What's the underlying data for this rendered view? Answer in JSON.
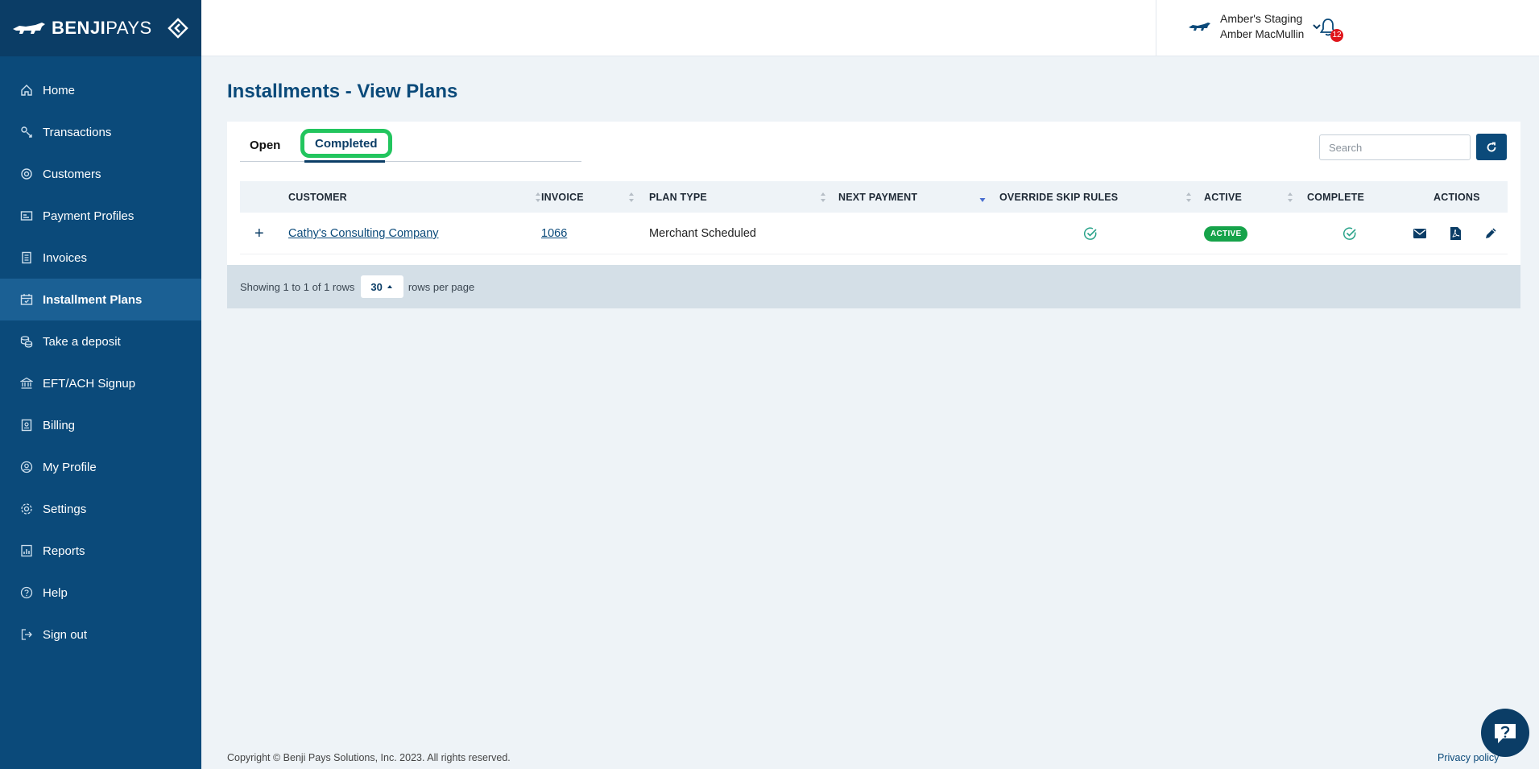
{
  "brand": {
    "name_bold": "BENJI",
    "name_thin": "PAYS"
  },
  "colors": {
    "sidebar": "#0b4a7a",
    "accent": "#0b3d66",
    "highlight": "#22c55e",
    "active_badge": "#16a34a",
    "notification": "#e0161b"
  },
  "sidebar": {
    "items": [
      {
        "label": "Home",
        "icon": "home-icon"
      },
      {
        "label": "Transactions",
        "icon": "transactions-icon"
      },
      {
        "label": "Customers",
        "icon": "customers-icon"
      },
      {
        "label": "Payment Profiles",
        "icon": "payment-profiles-icon"
      },
      {
        "label": "Invoices",
        "icon": "invoices-icon"
      },
      {
        "label": "Installment Plans",
        "icon": "calendar-icon",
        "active": true
      },
      {
        "label": "Take a deposit",
        "icon": "coins-icon"
      },
      {
        "label": "EFT/ACH Signup",
        "icon": "bank-icon"
      },
      {
        "label": "Billing",
        "icon": "billing-icon"
      },
      {
        "label": "My Profile",
        "icon": "user-icon"
      },
      {
        "label": "Settings",
        "icon": "gear-icon"
      },
      {
        "label": "Reports",
        "icon": "reports-icon"
      },
      {
        "label": "Help",
        "icon": "help-icon"
      },
      {
        "label": "Sign out",
        "icon": "sign-out-icon"
      }
    ]
  },
  "topbar": {
    "notification_count": "12",
    "account_name": "Amber's Staging",
    "user_name": "Amber MacMullin"
  },
  "page": {
    "title": "Installments - View Plans"
  },
  "tabs": {
    "open": "Open",
    "completed": "Completed"
  },
  "search": {
    "placeholder": "Search"
  },
  "table": {
    "columns": [
      "CUSTOMER",
      "INVOICE",
      "PLAN TYPE",
      "NEXT PAYMENT",
      "OVERRIDE SKIP RULES",
      "ACTIVE",
      "COMPLETE",
      "ACTIONS"
    ],
    "rows": [
      {
        "expand": "+",
        "customer": "Cathy's Consulting Company",
        "invoice": "1066",
        "plan_type": "Merchant Scheduled",
        "next_payment": "",
        "override_skip_rules": true,
        "active": "ACTIVE",
        "complete": true
      }
    ]
  },
  "pagination": {
    "showing": "Showing 1 to 1 of 1 rows",
    "per_page": "30",
    "per_page_suffix": "rows per page"
  },
  "footer": {
    "copyright": "Copyright © Benji Pays Solutions, Inc. 2023. All rights reserved.",
    "privacy": "Privacy policy"
  }
}
